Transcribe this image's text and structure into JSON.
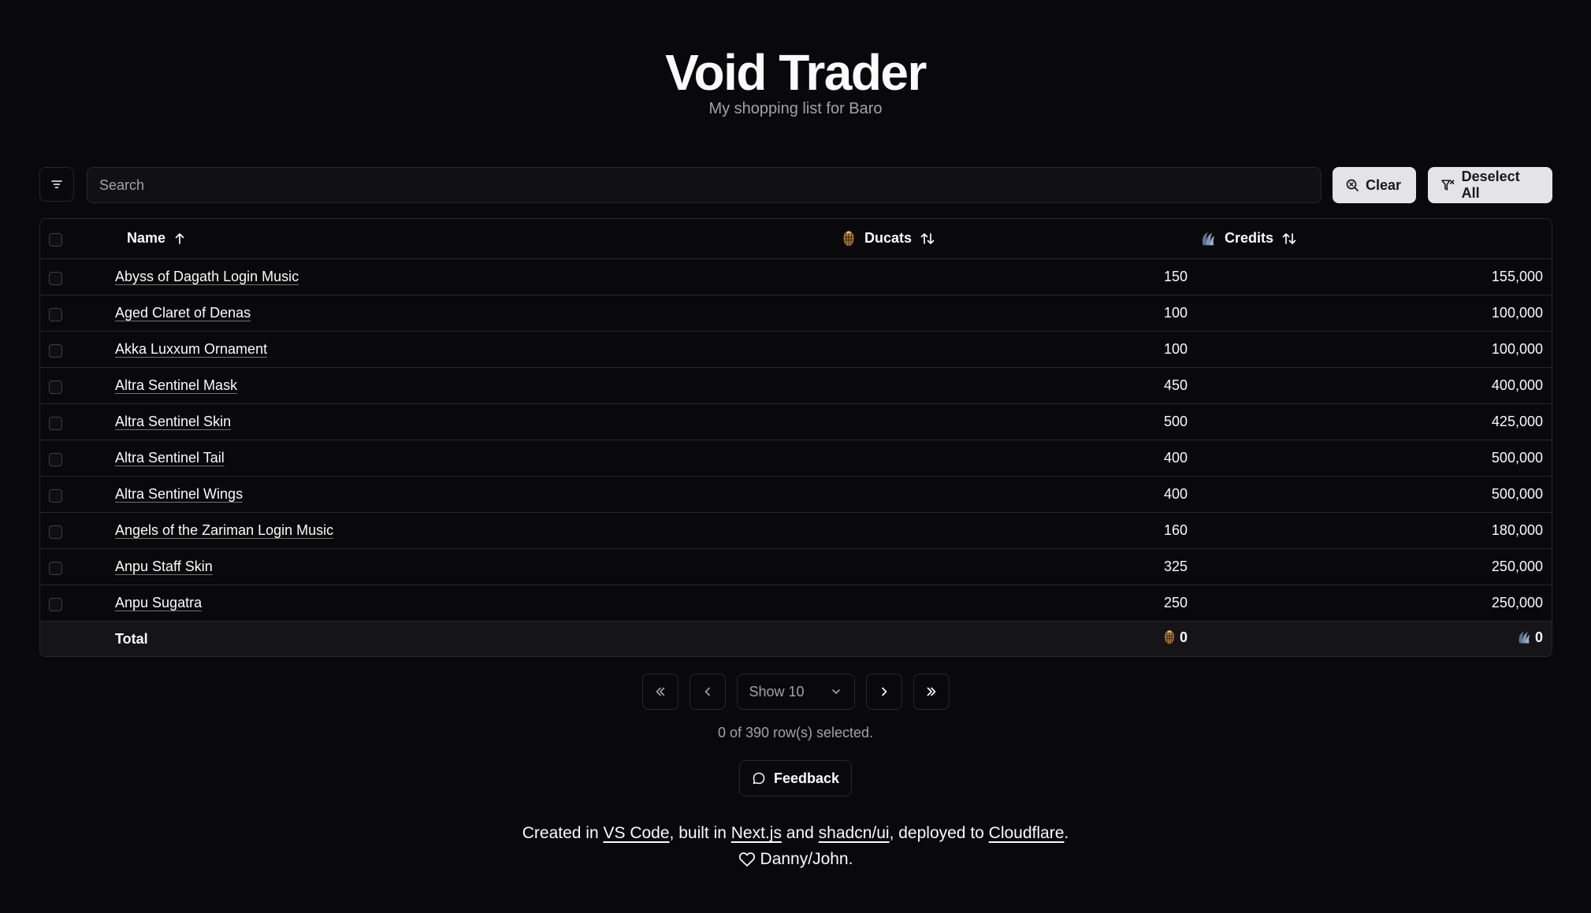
{
  "header": {
    "title": "Void Trader",
    "subtitle": "My shopping list for Baro"
  },
  "toolbar": {
    "filter_icon": "filter-lines-icon",
    "search_placeholder": "Search",
    "search_value": "",
    "clear_label": "Clear",
    "deselect_label": "Deselect All"
  },
  "table": {
    "columns": {
      "name": "Name",
      "ducats": "Ducats",
      "credits": "Credits"
    },
    "rows": [
      {
        "name": "Abyss of Dagath Login Music",
        "ducats": "150",
        "credits": "155,000"
      },
      {
        "name": "Aged Claret of Denas",
        "ducats": "100",
        "credits": "100,000"
      },
      {
        "name": "Akka Luxxum Ornament",
        "ducats": "100",
        "credits": "100,000"
      },
      {
        "name": "Altra Sentinel Mask",
        "ducats": "450",
        "credits": "400,000"
      },
      {
        "name": "Altra Sentinel Skin",
        "ducats": "500",
        "credits": "425,000"
      },
      {
        "name": "Altra Sentinel Tail",
        "ducats": "400",
        "credits": "500,000"
      },
      {
        "name": "Altra Sentinel Wings",
        "ducats": "400",
        "credits": "500,000"
      },
      {
        "name": "Angels of the Zariman Login Music",
        "ducats": "160",
        "credits": "180,000"
      },
      {
        "name": "Anpu Staff Skin",
        "ducats": "325",
        "credits": "250,000"
      },
      {
        "name": "Anpu Sugatra",
        "ducats": "250",
        "credits": "250,000"
      }
    ],
    "total": {
      "label": "Total",
      "ducats": "0",
      "credits": "0"
    }
  },
  "pagination": {
    "page_size_label": "Show 10",
    "selected_text": "0 of 390 row(s) selected."
  },
  "feedback": {
    "label": "Feedback"
  },
  "footer": {
    "text_1": "Created in ",
    "link_vscode": "VS Code",
    "text_2": ", built in ",
    "link_nextjs": "Next.js",
    "text_3": " and ",
    "link_shadcn": "shadcn/ui",
    "text_4": ", deployed to ",
    "link_cloudflare": "Cloudflare",
    "text_5": ".",
    "credit": "Danny/John."
  },
  "colors": {
    "background": "#09090b",
    "ducat_gold": "#c8964a",
    "credit_blue": "#6d8aa8",
    "button_light": "#e4e4e7"
  }
}
